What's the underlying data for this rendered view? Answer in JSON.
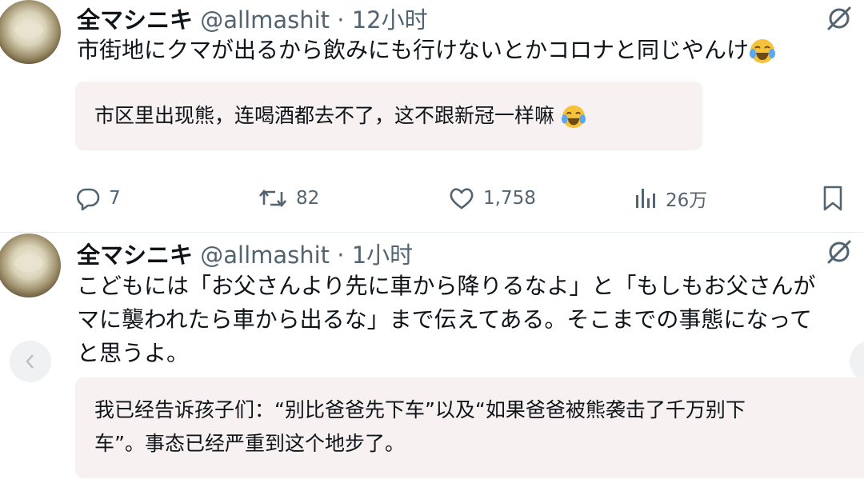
{
  "tweet1": {
    "name": "全マシニキ",
    "handle": "@allmashit",
    "separator": "·",
    "time": "12小时",
    "text": "市街地にクマが出るから飲みにも行けないとかコロナと同じやんけ",
    "emoji": "laughing-tears",
    "translation": "市区里出现熊，连喝酒都去不了，这不跟新冠一样嘛",
    "stats": {
      "replies": "7",
      "retweets": "82",
      "likes": "1,758",
      "views": "26万"
    }
  },
  "tweet2": {
    "name": "全マシニキ",
    "handle": "@allmashit",
    "separator": "·",
    "time": "1小时",
    "lines": [
      "こどもには「お父さんより先に車から降りるなよ」と「もしもお父さんが",
      "マに襲われたら車から出るな」まで伝えてある。そこまでの事態になって",
      "と思うよ。"
    ],
    "translation_lines": [
      "我已经告诉孩子们：“别比爸爸先下车”以及“如果爸爸被熊袭击了千万别下",
      "车”。事态已经严重到这个地步了。"
    ]
  },
  "icons": {
    "reply": "reply-icon",
    "retweet": "retweet-icon",
    "like": "heart-icon",
    "views": "views-icon",
    "bookmark": "bookmark-icon",
    "grok": "grok-icon",
    "carousel_prev": "chevron-left-icon"
  },
  "colors": {
    "muted": "#536471",
    "translation_bg": "#f7f1f1",
    "text": "#0f1419"
  }
}
